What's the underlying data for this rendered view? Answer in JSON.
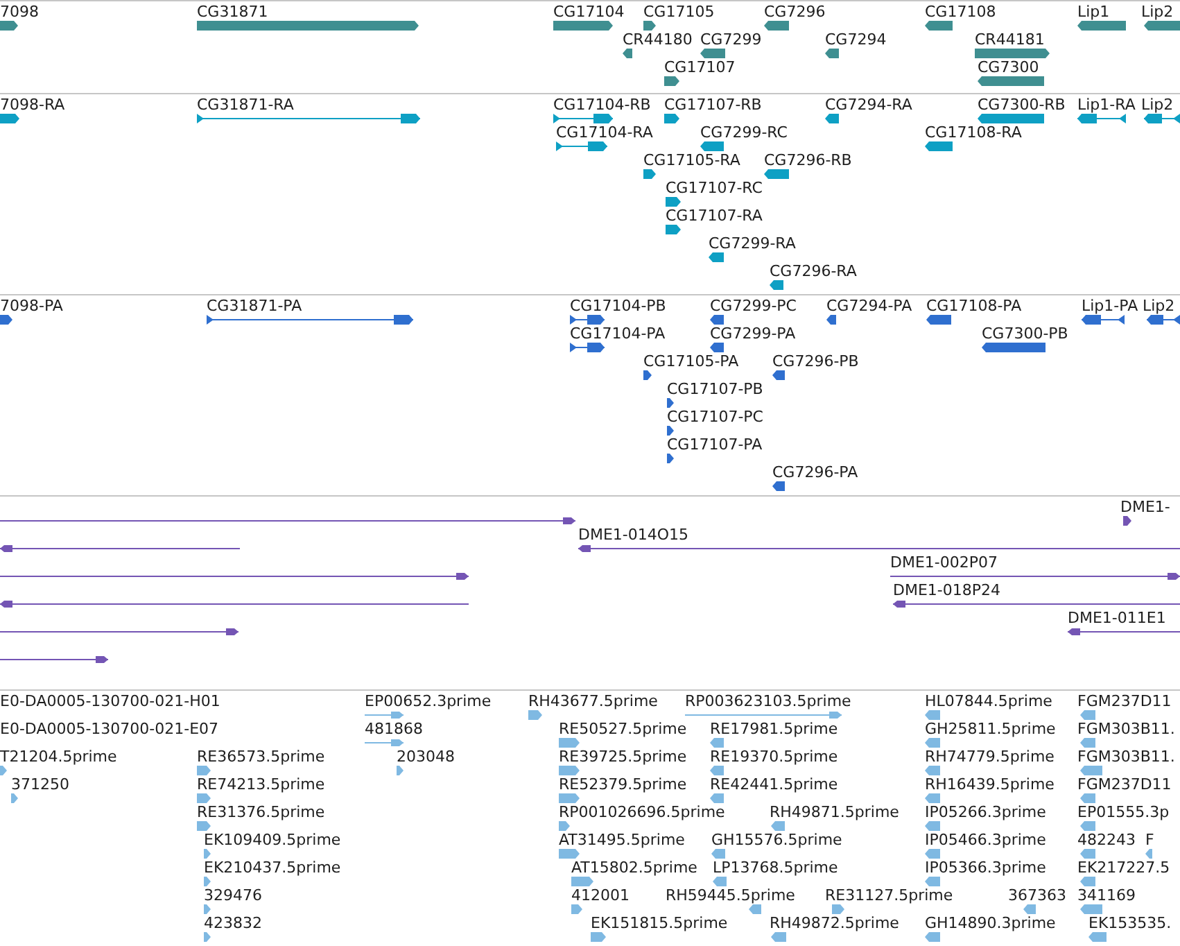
{
  "tracks": [
    {
      "color": "#3f8f91",
      "features": [
        {
          "label": "7098",
          "reverse": false,
          "kind": "block"
        },
        {
          "label": "CG31871",
          "reverse": false,
          "kind": "block"
        },
        {
          "label": "CG17104",
          "reverse": false,
          "kind": "block"
        },
        {
          "label": "CG17105",
          "reverse": false,
          "kind": "block"
        },
        {
          "label": "CG7296",
          "reverse": true,
          "kind": "block"
        },
        {
          "label": "CG17108",
          "reverse": true,
          "kind": "block"
        },
        {
          "label": "Lip1",
          "reverse": true,
          "kind": "block"
        },
        {
          "label": "Lip2",
          "reverse": true,
          "kind": "block"
        },
        {
          "label": "CR44180",
          "reverse": true,
          "kind": "block"
        },
        {
          "label": "CG7299",
          "reverse": true,
          "kind": "block"
        },
        {
          "label": "CG7294",
          "reverse": true,
          "kind": "block"
        },
        {
          "label": "CR44181",
          "reverse": false,
          "kind": "block"
        },
        {
          "label": "CG17107",
          "reverse": false,
          "kind": "block"
        },
        {
          "label": "CG7300",
          "reverse": true,
          "kind": "block"
        }
      ]
    },
    {
      "color": "#0ea0c4",
      "features": [
        {
          "label": "7098-RA",
          "reverse": false,
          "kind": "block"
        },
        {
          "label": "CG31871-RA",
          "reverse": false,
          "kind": "spliced"
        },
        {
          "label": "CG17104-RB",
          "reverse": false,
          "kind": "spliced"
        },
        {
          "label": "CG17107-RB",
          "reverse": false,
          "kind": "block"
        },
        {
          "label": "CG7294-RA",
          "reverse": true,
          "kind": "block"
        },
        {
          "label": "CG7300-RB",
          "reverse": true,
          "kind": "block"
        },
        {
          "label": "Lip1-RA",
          "reverse": true,
          "kind": "spliced"
        },
        {
          "label": "Lip2",
          "reverse": true,
          "kind": "spliced"
        },
        {
          "label": "CG17104-RA",
          "reverse": false,
          "kind": "spliced"
        },
        {
          "label": "CG7299-RC",
          "reverse": true,
          "kind": "block"
        },
        {
          "label": "CG17108-RA",
          "reverse": true,
          "kind": "block"
        },
        {
          "label": "CG17105-RA",
          "reverse": false,
          "kind": "block"
        },
        {
          "label": "CG7296-RB",
          "reverse": true,
          "kind": "block"
        },
        {
          "label": "CG17107-RC",
          "reverse": false,
          "kind": "block"
        },
        {
          "label": "CG17107-RA",
          "reverse": false,
          "kind": "block"
        },
        {
          "label": "CG7299-RA",
          "reverse": true,
          "kind": "block"
        },
        {
          "label": "CG7296-RA",
          "reverse": true,
          "kind": "block"
        }
      ]
    },
    {
      "color": "#2f6fcf",
      "features": [
        {
          "label": "7098-PA",
          "reverse": false,
          "kind": "block"
        },
        {
          "label": "CG31871-PA",
          "reverse": false,
          "kind": "spliced"
        },
        {
          "label": "CG17104-PB",
          "reverse": false,
          "kind": "spliced"
        },
        {
          "label": "CG7299-PC",
          "reverse": true,
          "kind": "block"
        },
        {
          "label": "CG7294-PA",
          "reverse": true,
          "kind": "block"
        },
        {
          "label": "CG17108-PA",
          "reverse": true,
          "kind": "block"
        },
        {
          "label": "Lip1-PA",
          "reverse": true,
          "kind": "spliced"
        },
        {
          "label": "Lip2",
          "reverse": true,
          "kind": "spliced"
        },
        {
          "label": "CG17104-PA",
          "reverse": false,
          "kind": "spliced"
        },
        {
          "label": "CG7299-PA",
          "reverse": true,
          "kind": "block"
        },
        {
          "label": "CG7300-PB",
          "reverse": true,
          "kind": "block"
        },
        {
          "label": "CG17105-PA",
          "reverse": false,
          "kind": "block"
        },
        {
          "label": "CG7296-PB",
          "reverse": true,
          "kind": "block"
        },
        {
          "label": "CG17107-PB",
          "reverse": false,
          "kind": "block"
        },
        {
          "label": "CG17107-PC",
          "reverse": false,
          "kind": "block"
        },
        {
          "label": "CG17107-PA",
          "reverse": false,
          "kind": "block"
        },
        {
          "label": "CG7296-PA",
          "reverse": true,
          "kind": "block"
        }
      ]
    },
    {
      "color": "#7455b4",
      "features": [
        {
          "reverse": false,
          "kind": "line"
        },
        {
          "label": "DME1-",
          "reverse": false,
          "kind": "block"
        },
        {
          "reverse": true,
          "kind": "line"
        },
        {
          "label": "DME1-014O15",
          "reverse": true,
          "kind": "line"
        },
        {
          "reverse": false,
          "kind": "line"
        },
        {
          "label": "DME1-002P07",
          "reverse": false,
          "kind": "line"
        },
        {
          "reverse": true,
          "kind": "line"
        },
        {
          "label": "DME1-018P24",
          "reverse": true,
          "kind": "line"
        },
        {
          "reverse": false,
          "kind": "line"
        },
        {
          "label": "DME1-011E1",
          "reverse": true,
          "kind": "line"
        },
        {
          "reverse": false,
          "kind": "line"
        }
      ]
    },
    {
      "color": "#7fb9e2",
      "features": [
        {
          "label": "E0-DA0005-130700-021-H01"
        },
        {
          "label": "EP00652.3prime",
          "reverse": false,
          "kind": "line"
        },
        {
          "label": "RH43677.5prime",
          "reverse": false,
          "kind": "block"
        },
        {
          "label": "RP003623103.5prime",
          "reverse": false,
          "kind": "line"
        },
        {
          "label": "HL07844.5prime",
          "reverse": true,
          "kind": "block"
        },
        {
          "label": "FGM237D11",
          "reverse": true,
          "kind": "block"
        },
        {
          "label": "E0-DA0005-130700-021-E07"
        },
        {
          "label": "481868",
          "reverse": false,
          "kind": "line"
        },
        {
          "label": "RE50527.5prime",
          "reverse": false,
          "kind": "block"
        },
        {
          "label": "RE17981.5prime",
          "reverse": true,
          "kind": "block"
        },
        {
          "label": "GH25811.5prime",
          "reverse": true,
          "kind": "block"
        },
        {
          "label": "FGM303B11.",
          "reverse": true,
          "kind": "block"
        },
        {
          "label": "T21204.5prime",
          "reverse": false,
          "kind": "block"
        },
        {
          "label": "RE36573.5prime",
          "reverse": false,
          "kind": "block"
        },
        {
          "label": "203048",
          "reverse": false,
          "kind": "block"
        },
        {
          "label": "RE39725.5prime",
          "reverse": false,
          "kind": "block"
        },
        {
          "label": "RE19370.5prime",
          "reverse": true,
          "kind": "block"
        },
        {
          "label": "RH74779.5prime",
          "reverse": true,
          "kind": "block"
        },
        {
          "label": "FGM303B11.",
          "reverse": true,
          "kind": "block"
        },
        {
          "label": "371250",
          "reverse": false,
          "kind": "block"
        },
        {
          "label": "RE74213.5prime",
          "reverse": false,
          "kind": "block"
        },
        {
          "label": "RE52379.5prime",
          "reverse": false,
          "kind": "block"
        },
        {
          "label": "RE42441.5prime",
          "reverse": true,
          "kind": "block"
        },
        {
          "label": "RH16439.5prime",
          "reverse": true,
          "kind": "block"
        },
        {
          "label": "FGM237D11",
          "reverse": true,
          "kind": "block"
        },
        {
          "label": "RE31376.5prime",
          "reverse": false,
          "kind": "block"
        },
        {
          "label": "RP001026696.5prime",
          "reverse": false,
          "kind": "block"
        },
        {
          "label": "RH49871.5prime",
          "reverse": true,
          "kind": "block"
        },
        {
          "label": "IP05266.3prime",
          "reverse": true,
          "kind": "block"
        },
        {
          "label": "EP01555.3p",
          "reverse": true,
          "kind": "block"
        },
        {
          "label": "EK109409.5prime",
          "reverse": false,
          "kind": "block"
        },
        {
          "label": "AT31495.5prime",
          "reverse": false,
          "kind": "block"
        },
        {
          "label": "GH15576.5prime",
          "reverse": true,
          "kind": "block"
        },
        {
          "label": "IP05466.3prime",
          "reverse": true,
          "kind": "block"
        },
        {
          "label": "482243",
          "reverse": true,
          "kind": "block"
        },
        {
          "label": "F",
          "reverse": true,
          "kind": "block"
        },
        {
          "label": "EK210437.5prime",
          "reverse": false,
          "kind": "block"
        },
        {
          "label": "AT15802.5prime",
          "reverse": false,
          "kind": "block"
        },
        {
          "label": "LP13768.5prime",
          "reverse": true,
          "kind": "block"
        },
        {
          "label": "IP05366.3prime",
          "reverse": true,
          "kind": "block"
        },
        {
          "label": "EK217227.5",
          "reverse": true,
          "kind": "block"
        },
        {
          "label": "329476",
          "reverse": false,
          "kind": "block"
        },
        {
          "label": "412001",
          "reverse": false,
          "kind": "block"
        },
        {
          "label": "RH59445.5prime",
          "reverse": true,
          "kind": "block"
        },
        {
          "label": "RE31127.5prime",
          "reverse": false,
          "kind": "block"
        },
        {
          "label": "367363",
          "reverse": true,
          "kind": "block"
        },
        {
          "label": "341169",
          "reverse": true,
          "kind": "block"
        },
        {
          "label": "423832",
          "reverse": false,
          "kind": "block"
        },
        {
          "label": "EK151815.5prime",
          "reverse": false,
          "kind": "block"
        },
        {
          "label": "RH49872.5prime",
          "reverse": true,
          "kind": "block"
        },
        {
          "label": "GH14890.3prime",
          "reverse": true,
          "kind": "block"
        },
        {
          "label": "EK153535.",
          "reverse": true,
          "kind": "block"
        }
      ]
    }
  ]
}
